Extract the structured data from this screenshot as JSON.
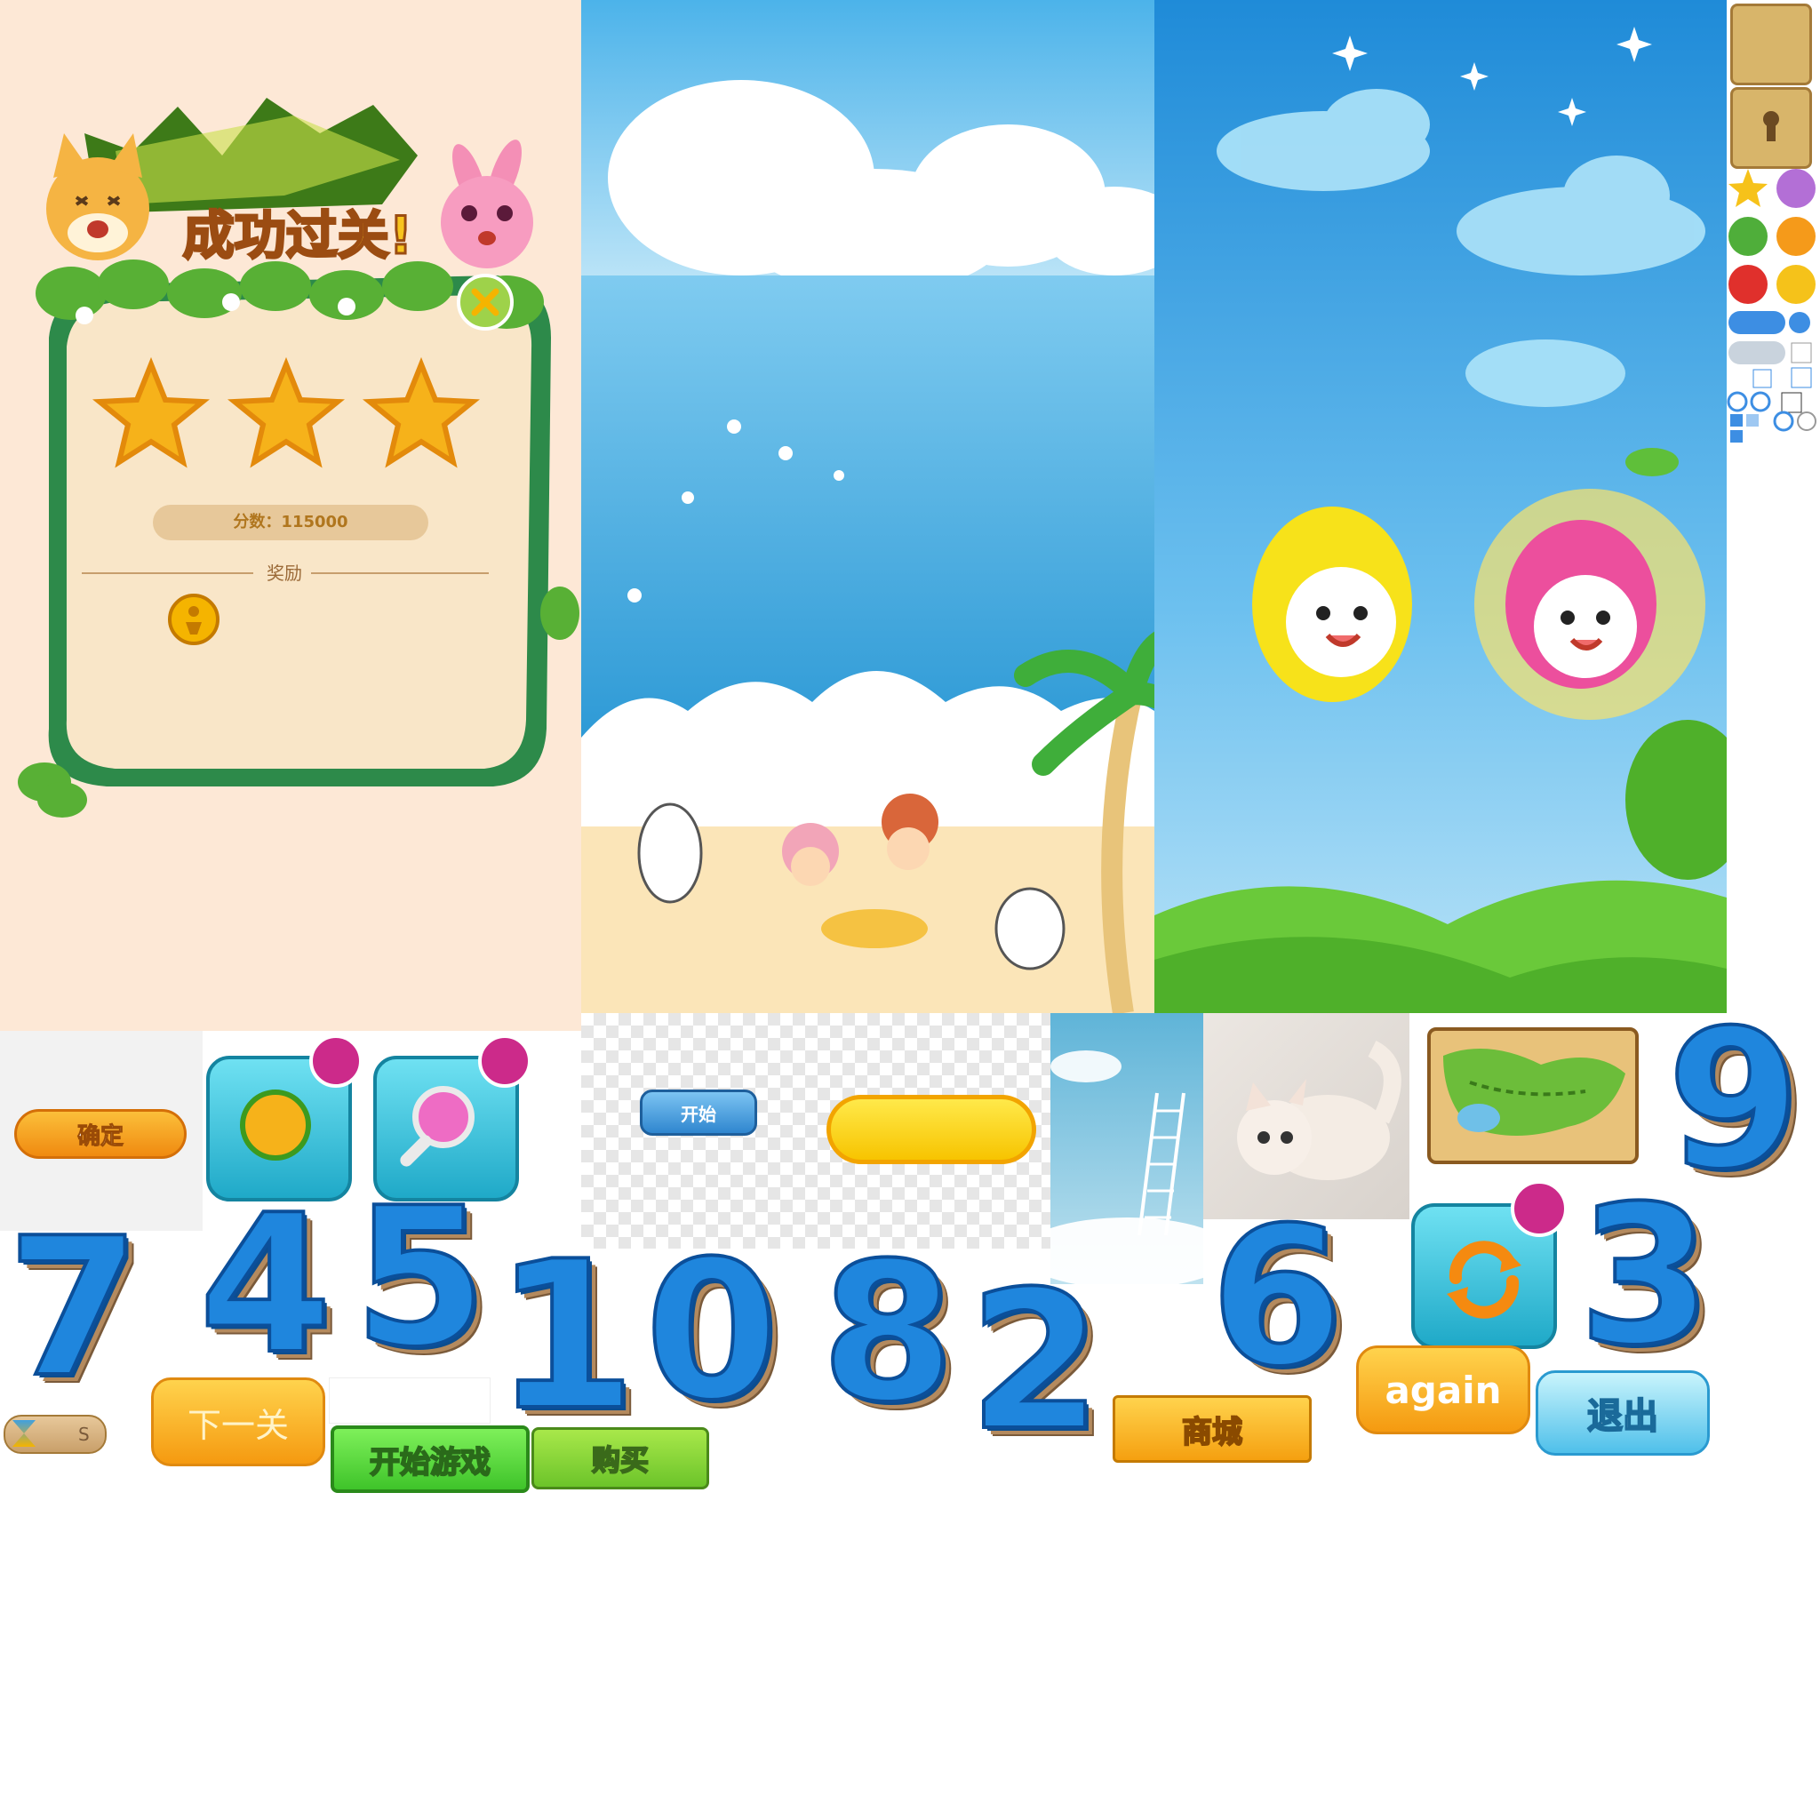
{
  "victory_panel": {
    "title": "成功过关!",
    "score_label": "分数：115000",
    "reward_label": "奖励"
  },
  "buttons": {
    "confirm": "确定",
    "start_small": "开始",
    "next_level": "下一关",
    "start_game": "开始游戏",
    "buy": "购买",
    "shop": "商城",
    "again": "again",
    "exit": "退出",
    "timer_s": "S"
  },
  "digits": {
    "d7": "7",
    "d4": "4",
    "d5": "5",
    "d1": "1",
    "d0": "0",
    "d8": "8",
    "d2": "2",
    "d6": "6",
    "d3": "3",
    "d9": "9"
  },
  "colors": {
    "panel_bg": "#fde8d6",
    "sky": "#3fa9e8",
    "digit_blue": "#1f86dd",
    "orange_btn": "#f7a21b",
    "green_btn": "#5fd93a",
    "badge": "#cc2a8a"
  }
}
